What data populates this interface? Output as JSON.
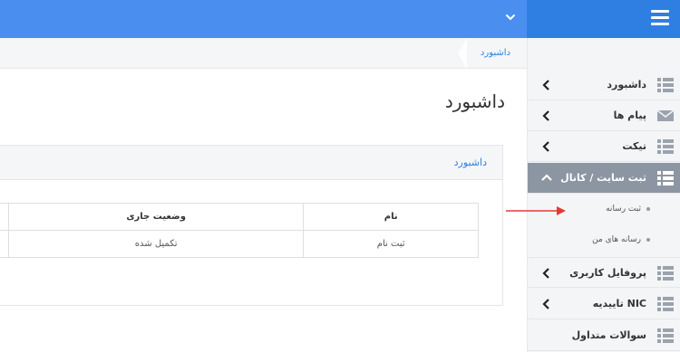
{
  "header": {
    "menu_icon": "hamburger-icon",
    "dropdown_icon": "chevron-down-icon",
    "brand_color": "#2f7fe2"
  },
  "breadcrumb": {
    "current": "داشبورد"
  },
  "page": {
    "title": "داشبورد"
  },
  "panel": {
    "title": "داشبورد",
    "table": {
      "headers": [
        "وضعیت جاری",
        "نام"
      ],
      "rows": [
        {
          "status": "تکمیل شده",
          "name": "ثبت نام"
        }
      ]
    }
  },
  "sidebar": {
    "items": [
      {
        "label": "داشبورد",
        "icon": "grid-icon"
      },
      {
        "label": "پیام ها",
        "icon": "envelope-icon"
      },
      {
        "label": "تیکت",
        "icon": "grid-icon"
      },
      {
        "label": "ثبت سایت / کانال",
        "icon": "grid-icon",
        "expanded": true
      },
      {
        "label": "پروفایل کاربری",
        "icon": "grid-icon"
      },
      {
        "label": "تاییدیه NIC",
        "icon": "grid-icon"
      },
      {
        "label": "سوالات متداول",
        "icon": "grid-icon"
      }
    ],
    "subitems": [
      {
        "label": "ثبت رسانه"
      },
      {
        "label": "رسانه های من"
      }
    ]
  },
  "annotation": {
    "pointer_color": "#e53935"
  }
}
